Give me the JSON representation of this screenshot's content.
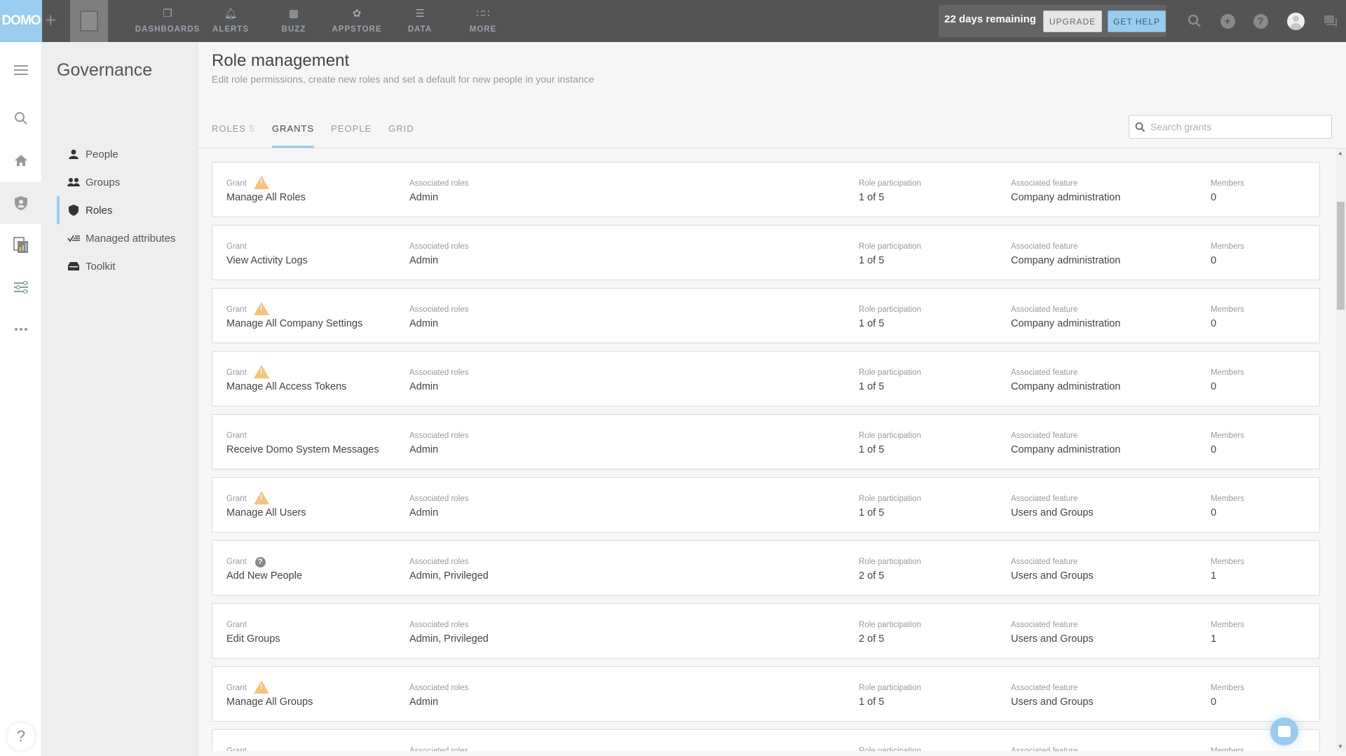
{
  "topbar": {
    "logo": "DOMO",
    "plus_icon": "plus-icon",
    "nav": [
      {
        "label": "DASHBOARDS",
        "icon": "dashboards-icon"
      },
      {
        "label": "ALERTS",
        "icon": "bell-icon"
      },
      {
        "label": "BUZZ",
        "icon": "chat-icon"
      },
      {
        "label": "APPSTORE",
        "icon": "appstore-icon"
      },
      {
        "label": "DATA",
        "icon": "database-icon"
      },
      {
        "label": "MORE",
        "icon": "grid-icon"
      }
    ],
    "trial_text": "22 days remaining",
    "upgrade_label": "UPGRADE",
    "get_help_label": "GET HELP"
  },
  "rail": {
    "help_label": "?"
  },
  "governance": {
    "title": "Governance",
    "items": [
      {
        "label": "People",
        "icon": "person-icon"
      },
      {
        "label": "Groups",
        "icon": "group-icon"
      },
      {
        "label": "Roles",
        "icon": "shield-icon",
        "active": true
      },
      {
        "label": "Managed attributes",
        "icon": "attributes-icon"
      },
      {
        "label": "Toolkit",
        "icon": "toolkit-icon"
      }
    ]
  },
  "main": {
    "title": "Role management",
    "subtitle": "Edit role permissions, create new roles and set a default for new people in your instance",
    "tabs": [
      {
        "label": "ROLES",
        "count": "5"
      },
      {
        "label": "GRANTS",
        "active": true
      },
      {
        "label": "PEOPLE"
      },
      {
        "label": "GRID"
      }
    ],
    "search_placeholder": "Search grants",
    "labels": {
      "grant": "Grant",
      "roles": "Associated roles",
      "participation": "Role participation",
      "feature": "Associated feature",
      "members": "Members"
    },
    "grants": [
      {
        "name": "Manage All Roles",
        "badge": "warning",
        "roles": "Admin",
        "participation": "1 of 5",
        "feature": "Company administration",
        "members": "0"
      },
      {
        "name": "View Activity Logs",
        "badge": "",
        "roles": "Admin",
        "participation": "1 of 5",
        "feature": "Company administration",
        "members": "0"
      },
      {
        "name": "Manage All Company Settings",
        "badge": "warning",
        "roles": "Admin",
        "participation": "1 of 5",
        "feature": "Company administration",
        "members": "0"
      },
      {
        "name": "Manage All Access Tokens",
        "badge": "warning",
        "roles": "Admin",
        "participation": "1 of 5",
        "feature": "Company administration",
        "members": "0"
      },
      {
        "name": "Receive Domo System Messages",
        "badge": "",
        "roles": "Admin",
        "participation": "1 of 5",
        "feature": "Company administration",
        "members": "0"
      },
      {
        "name": "Manage All Users",
        "badge": "warning",
        "roles": "Admin",
        "participation": "1 of 5",
        "feature": "Users and Groups",
        "members": "0"
      },
      {
        "name": "Add New People",
        "badge": "help",
        "roles": "Admin, Privileged",
        "participation": "2 of 5",
        "feature": "Users and Groups",
        "members": "1"
      },
      {
        "name": "Edit Groups",
        "badge": "",
        "roles": "Admin, Privileged",
        "participation": "2 of 5",
        "feature": "Users and Groups",
        "members": "1"
      },
      {
        "name": "Manage All Groups",
        "badge": "warning",
        "roles": "Admin",
        "participation": "1 of 5",
        "feature": "Users and Groups",
        "members": "0"
      },
      {
        "name": "",
        "badge": "",
        "roles": "",
        "participation": "",
        "feature": "",
        "members": ""
      }
    ]
  }
}
